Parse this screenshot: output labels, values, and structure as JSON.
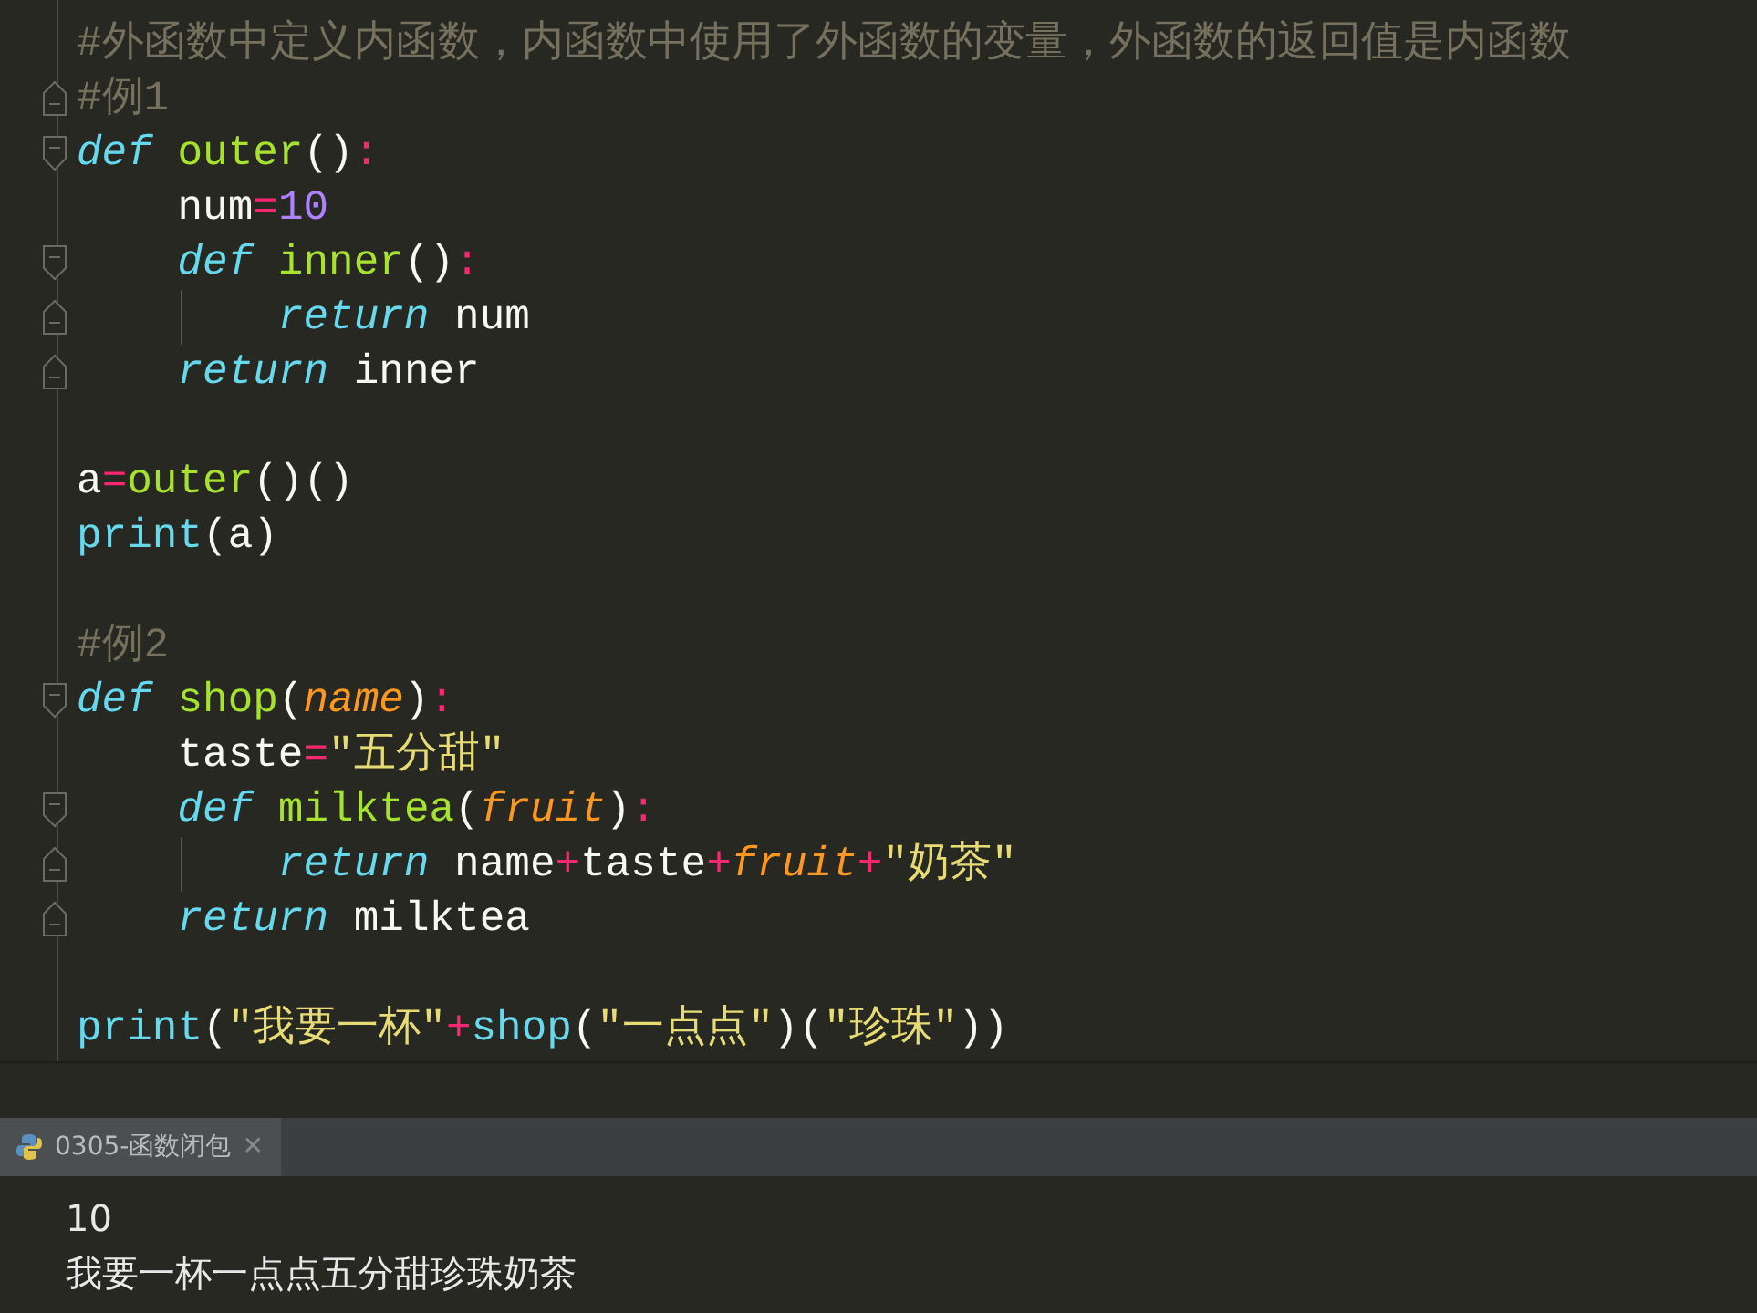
{
  "editor": {
    "blocks": [
      {
        "lines": [
          {
            "tokens": [
              {
                "kind": "comment",
                "text": "#外函数中定义内函数，内函数中使用了外函数的变量，外函数的返回值是内函数"
              }
            ]
          },
          {
            "fold_end": true,
            "tokens": [
              {
                "kind": "comment",
                "text": "#例1"
              }
            ]
          },
          {
            "fold_start": true,
            "tokens": [
              {
                "kind": "keyword",
                "text": "def"
              },
              {
                "kind": "function",
                "text": " outer"
              },
              {
                "kind": "plain",
                "text": "()"
              },
              {
                "kind": "operator",
                "text": ":"
              }
            ]
          },
          {
            "tokens": [
              {
                "kind": "plain",
                "text": "    num"
              },
              {
                "kind": "operator",
                "text": "="
              },
              {
                "kind": "number",
                "text": "10"
              }
            ]
          },
          {
            "fold_start": true,
            "tokens": [
              {
                "kind": "keyword",
                "text": "    def"
              },
              {
                "kind": "function",
                "text": " inner"
              },
              {
                "kind": "plain",
                "text": "()"
              },
              {
                "kind": "operator",
                "text": ":"
              }
            ]
          },
          {
            "fold_end": true,
            "guide": true,
            "tokens": [
              {
                "kind": "keyword",
                "text": "        return"
              },
              {
                "kind": "plain",
                "text": " num"
              }
            ]
          },
          {
            "fold_end": true,
            "tokens": [
              {
                "kind": "keyword",
                "text": "    return"
              },
              {
                "kind": "plain",
                "text": " inner"
              }
            ]
          }
        ]
      },
      {
        "lines": [
          {
            "tokens": [
              {
                "kind": "plain",
                "text": "a"
              },
              {
                "kind": "operator",
                "text": "="
              },
              {
                "kind": "function",
                "text": "outer"
              },
              {
                "kind": "plain",
                "text": "()()"
              }
            ]
          },
          {
            "tokens": [
              {
                "kind": "builtin",
                "text": "print"
              },
              {
                "kind": "plain",
                "text": "(a)"
              }
            ]
          }
        ]
      },
      {
        "lines": [
          {
            "tokens": [
              {
                "kind": "comment",
                "text": "#例2"
              }
            ]
          },
          {
            "fold_start": true,
            "tokens": [
              {
                "kind": "keyword",
                "text": "def"
              },
              {
                "kind": "function",
                "text": " shop"
              },
              {
                "kind": "plain",
                "text": "("
              },
              {
                "kind": "param",
                "text": "name"
              },
              {
                "kind": "plain",
                "text": ")"
              },
              {
                "kind": "operator",
                "text": ":"
              }
            ]
          },
          {
            "tokens": [
              {
                "kind": "plain",
                "text": "    taste"
              },
              {
                "kind": "operator",
                "text": "="
              },
              {
                "kind": "string",
                "text": "\"五分甜\""
              }
            ]
          },
          {
            "fold_start": true,
            "tokens": [
              {
                "kind": "keyword",
                "text": "    def"
              },
              {
                "kind": "function",
                "text": " milktea"
              },
              {
                "kind": "plain",
                "text": "("
              },
              {
                "kind": "param",
                "text": "fruit"
              },
              {
                "kind": "plain",
                "text": ")"
              },
              {
                "kind": "operator",
                "text": ":"
              }
            ]
          },
          {
            "fold_end": true,
            "guide": true,
            "tokens": [
              {
                "kind": "keyword",
                "text": "        return"
              },
              {
                "kind": "plain",
                "text": " name"
              },
              {
                "kind": "operator",
                "text": "+"
              },
              {
                "kind": "plain",
                "text": "taste"
              },
              {
                "kind": "operator",
                "text": "+"
              },
              {
                "kind": "param",
                "text": "fruit"
              },
              {
                "kind": "operator",
                "text": "+"
              },
              {
                "kind": "string",
                "text": "\"奶茶\""
              }
            ]
          },
          {
            "fold_end": true,
            "tokens": [
              {
                "kind": "keyword",
                "text": "    return"
              },
              {
                "kind": "plain",
                "text": " milktea"
              }
            ]
          }
        ]
      },
      {
        "lines": [
          {
            "tokens": [
              {
                "kind": "builtin",
                "text": "print"
              },
              {
                "kind": "plain",
                "text": "("
              },
              {
                "kind": "string",
                "text": "\"我要一杯\""
              },
              {
                "kind": "operator",
                "text": "+"
              },
              {
                "kind": "builtin",
                "text": "shop"
              },
              {
                "kind": "plain",
                "text": "("
              },
              {
                "kind": "string",
                "text": "\"一点点\""
              },
              {
                "kind": "plain",
                "text": ")("
              },
              {
                "kind": "string",
                "text": "\"珍珠\""
              },
              {
                "kind": "plain",
                "text": "))"
              }
            ]
          }
        ]
      }
    ]
  },
  "run_panel": {
    "tabs": [
      {
        "label": "0305-函数闭包",
        "close": "✕",
        "selected": true
      }
    ],
    "output": [
      "10",
      "我要一杯一点点五分甜珍珠奶茶"
    ]
  }
}
